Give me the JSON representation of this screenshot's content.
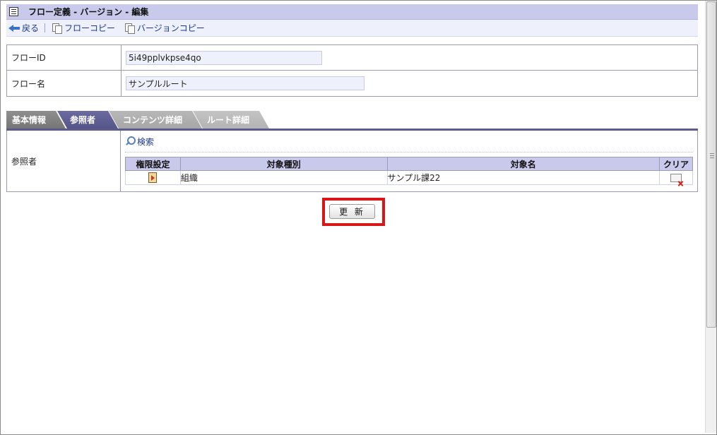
{
  "header": {
    "title": "フロー定義 - バージョン - 編集"
  },
  "toolbar": {
    "back_label": "戻る",
    "flow_copy_label": "フローコピー",
    "version_copy_label": "バージョンコピー"
  },
  "form": {
    "flow_id_label": "フローID",
    "flow_id_value": "5i49pplvkpse4qo",
    "flow_name_label": "フロー名",
    "flow_name_value": "サンプルルート"
  },
  "tabs": [
    {
      "label": "基本情報",
      "active": false
    },
    {
      "label": "参照者",
      "active": true
    },
    {
      "label": "コンテンツ詳細",
      "active": false
    },
    {
      "label": "ルート詳細",
      "active": false
    }
  ],
  "viewers": {
    "label": "参照者",
    "search_label": "検索",
    "columns": [
      "権限設定",
      "対象種別",
      "対象名",
      "クリア"
    ],
    "rows": [
      {
        "type": "組織",
        "name": "サンプル課22"
      }
    ]
  },
  "actions": {
    "update_label": "更 新"
  },
  "icons": {
    "title": "document-icon",
    "back": "back-arrow-icon",
    "copy": "copy-icon",
    "search": "search-icon",
    "auth": "permission-icon",
    "clear": "clear-icon"
  },
  "colors": {
    "header_bg": "#c9c9ec",
    "toolbar_bg": "#eef1fb",
    "active_tab": "#5b5b8f",
    "highlight": "#d81818",
    "link": "#1c3a8e"
  }
}
